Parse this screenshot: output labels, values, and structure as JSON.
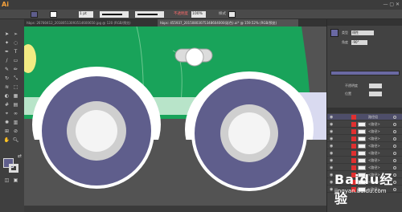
{
  "app": {
    "logo": "Ai"
  },
  "colors": {
    "wheel": "#5f5e8c",
    "hub_outer": "#cfcfcf",
    "hub_inner": "#f4f4f4",
    "car_body": "#19a35a",
    "car_trim": "#b8e4c9",
    "highlight": "#f2eb83",
    "tire_outline": "#ffffff",
    "fill_swatch": "#5f5e8c",
    "gradient_swatch": "#6a69a3"
  },
  "control_bar": {
    "stroke_weight": "1 pt",
    "opacity_label": "不透明度",
    "opacity_value": "100%",
    "style_label": "样式"
  },
  "document_tabs": [
    {
      "label": "hbps: 26780412_20180513093514600650.jpg @ 120 (RGB/预览)"
    },
    {
      "label": "hbps: 455937_20150803075348604000(彩色).ai* @ 159.52% (RGB/预览)"
    }
  ],
  "panel": {
    "type_label": "类型",
    "type_value": "线性",
    "angle_label": "角度",
    "angle_value": "-90°",
    "opacity_label": "不透明度",
    "location_label": "位置"
  },
  "layers": [
    {
      "name": "路径组"
    },
    {
      "name": "<路径>"
    },
    {
      "name": "<路径>"
    },
    {
      "name": "<路径>"
    },
    {
      "name": "<路径>"
    },
    {
      "name": "<路径>"
    },
    {
      "name": "<路径>"
    },
    {
      "name": "<路径>"
    },
    {
      "name": "<路径>"
    },
    {
      "name": "<路径>"
    },
    {
      "name": "<路径>"
    }
  ],
  "watermark": {
    "logo": "Baidu经验",
    "url": "jingyan.baidu.com"
  }
}
